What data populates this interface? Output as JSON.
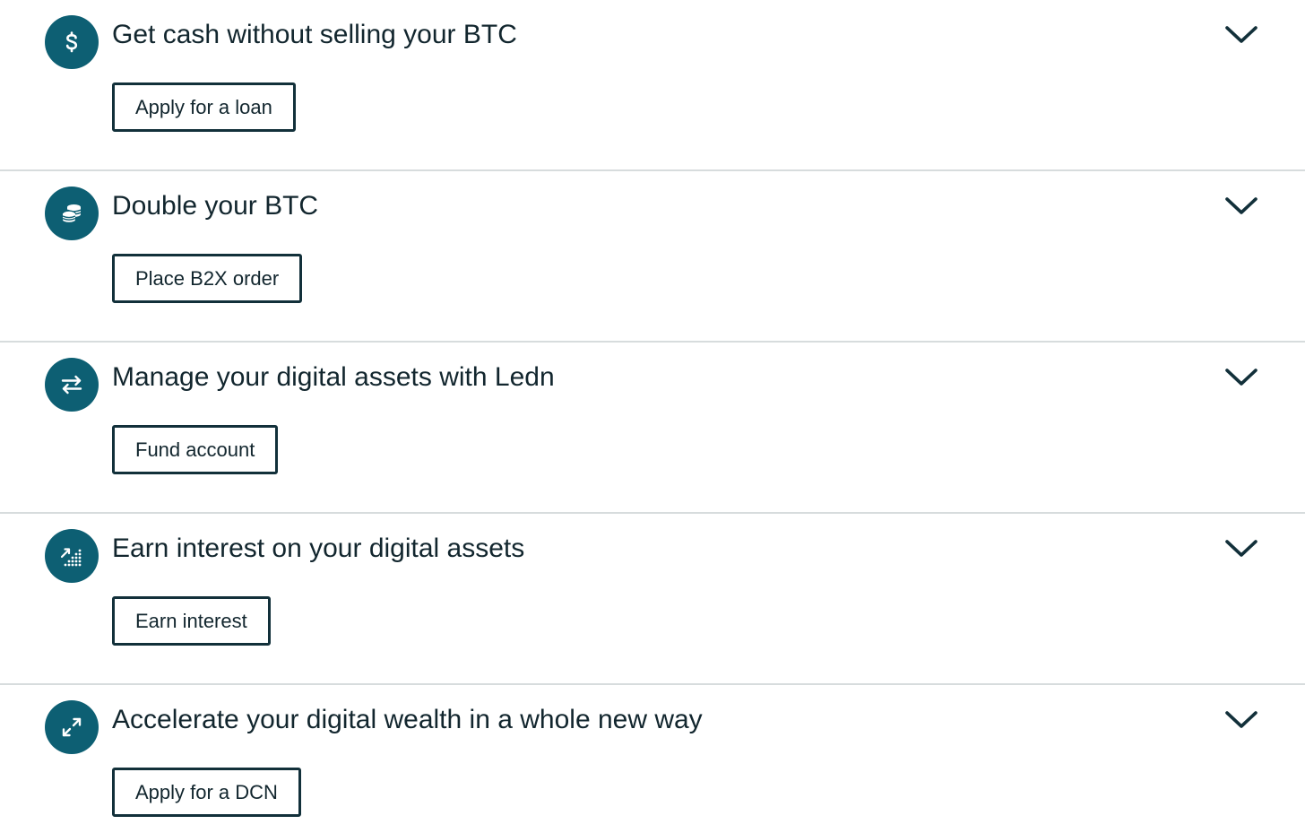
{
  "colors": {
    "icon_bg": "#0d5f73",
    "text": "#12262e",
    "button_border": "#12303a",
    "divider": "#d7dcdd"
  },
  "items": [
    {
      "icon": "dollar-icon",
      "title": "Get cash without selling your BTC",
      "button_label": "Apply for a loan"
    },
    {
      "icon": "coins-stack-icon",
      "title": "Double your BTC",
      "button_label": "Place B2X order"
    },
    {
      "icon": "swap-arrows-icon",
      "title": "Manage your digital assets with Ledn",
      "button_label": "Fund account"
    },
    {
      "icon": "interest-growth-icon",
      "title": "Earn interest on your digital assets",
      "button_label": "Earn interest"
    },
    {
      "icon": "expand-arrows-icon",
      "title": "Accelerate your digital wealth in a whole new way",
      "button_label": "Apply for a DCN"
    }
  ]
}
